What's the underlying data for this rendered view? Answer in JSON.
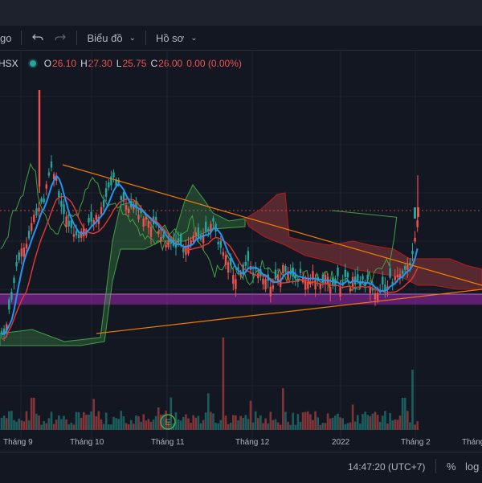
{
  "toolbar": {
    "partial_label": "go",
    "undo_icon": "undo-icon",
    "redo_icon": "redo-icon",
    "chart_menu_label": "Biểu đồ",
    "profile_menu_label": "Hồ sơ"
  },
  "legend": {
    "symbol_partial": "HSX",
    "status_color": "#26a69a",
    "open_label": "O",
    "open_value": "26.10",
    "high_label": "H",
    "high_value": "27.30",
    "low_label": "L",
    "low_value": "25.75",
    "close_label": "C",
    "close_value": "26.00",
    "change_value": "0.00 (0.00%)"
  },
  "colors": {
    "up": "#26a69a",
    "down": "#ef5350",
    "conversion_line": "#2196f3",
    "base_line": "#e53935",
    "lagging_span": "#43a047",
    "cloud_bull": "#4caf50",
    "cloud_bear": "#ef5350",
    "trendline": "#f57c00",
    "zone": "#9c27b0"
  },
  "chart_data": {
    "type": "candlestick",
    "indicators": [
      "Ichimoku Cloud",
      "Volume"
    ],
    "x_tick_labels": [
      "Tháng 9",
      "Tháng 10",
      "Tháng 11",
      "Tháng 12",
      "2022",
      "Tháng 2",
      "Tháng"
    ],
    "last_ohlc": {
      "open": 26.1,
      "high": 27.3,
      "low": 25.75,
      "close": 26.0
    },
    "grid": true
  },
  "events": {
    "earnings_marker": "E"
  },
  "status": {
    "time": "14:47:20 (UTC+7)",
    "percent_label": "%",
    "log_label": "log"
  }
}
